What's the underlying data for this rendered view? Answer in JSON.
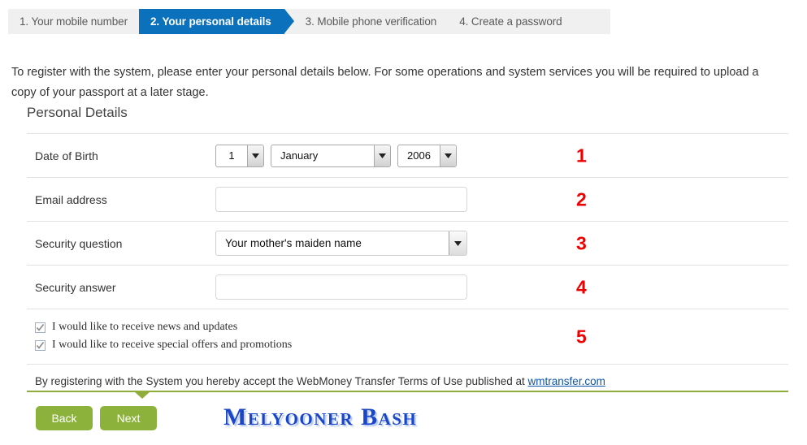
{
  "wizard": {
    "tabs": [
      {
        "label": "1. Your mobile number",
        "active": false
      },
      {
        "label": "2. Your personal details",
        "active": true
      },
      {
        "label": "3. Mobile phone verification",
        "active": false
      },
      {
        "label": "4. Create a password",
        "active": false
      }
    ],
    "active_color": "#0b71bd",
    "inactive_bg": "#f0f0f0"
  },
  "intro": {
    "text": "To register with the system, please enter your personal details below. For some operations and system services you will be required to upload a copy of your passport at a later stage."
  },
  "section": {
    "heading": "Personal Details"
  },
  "form": {
    "dob": {
      "label": "Date of Birth",
      "day": "1",
      "month": "January",
      "year": "2006",
      "marker": "1"
    },
    "email": {
      "label": "Email address",
      "value": "",
      "placeholder": "",
      "marker": "2"
    },
    "security_question": {
      "label": "Security question",
      "value": "Your mother's maiden name",
      "marker": "3"
    },
    "security_answer": {
      "label": "Security answer",
      "value": "",
      "placeholder": "",
      "marker": "4"
    },
    "subscriptions": {
      "marker": "5",
      "items": [
        {
          "label": "I would like to receive news and updates",
          "checked": true
        },
        {
          "label": "I would like to receive special offers and promotions",
          "checked": true
        }
      ]
    }
  },
  "terms": {
    "text": "By registering with the System you hereby accept the WebMoney Transfer Terms of Use published at ",
    "link_text": "wmtransfer.com"
  },
  "actions": {
    "back_label": "Back",
    "next_label": "Next",
    "button_color": "#8cb23c"
  },
  "watermark": {
    "text": "Melyooner Bash",
    "color": "#1a46c8"
  },
  "divider": {
    "color": "#8fad3a"
  }
}
